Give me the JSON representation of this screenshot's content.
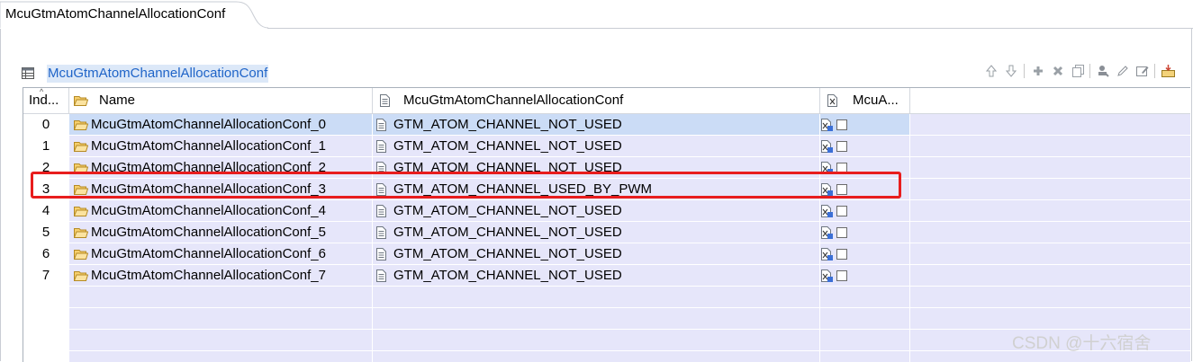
{
  "tab": {
    "label": "McuGtmAtomChannelAllocationConf"
  },
  "section": {
    "title": "McuGtmAtomChannelAllocationConf"
  },
  "toolbar": {
    "icons": [
      "arrow-up-icon",
      "arrow-down-icon",
      "add-icon",
      "delete-icon",
      "copy-icon",
      "stamp-icon",
      "edit-icon",
      "edit-properties-icon",
      "import-icon"
    ]
  },
  "table": {
    "columns": [
      {
        "label": "Ind..."
      },
      {
        "label": "Name"
      },
      {
        "label": "McuGtmAtomChannelAllocationConf"
      },
      {
        "label": "McuA..."
      }
    ],
    "rows": [
      {
        "index": "0",
        "name": "McuGtmAtomChannelAllocationConf_0",
        "value": "GTM_ATOM_CHANNEL_NOT_USED",
        "checked": false,
        "selected": true
      },
      {
        "index": "1",
        "name": "McuGtmAtomChannelAllocationConf_1",
        "value": "GTM_ATOM_CHANNEL_NOT_USED",
        "checked": false
      },
      {
        "index": "2",
        "name": "McuGtmAtomChannelAllocationConf_2",
        "value": "GTM_ATOM_CHANNEL_NOT_USED",
        "checked": false
      },
      {
        "index": "3",
        "name": "McuGtmAtomChannelAllocationConf_3",
        "value": "GTM_ATOM_CHANNEL_USED_BY_PWM",
        "checked": false,
        "highlighted": true
      },
      {
        "index": "4",
        "name": "McuGtmAtomChannelAllocationConf_4",
        "value": "GTM_ATOM_CHANNEL_NOT_USED",
        "checked": false
      },
      {
        "index": "5",
        "name": "McuGtmAtomChannelAllocationConf_5",
        "value": "GTM_ATOM_CHANNEL_NOT_USED",
        "checked": false
      },
      {
        "index": "6",
        "name": "McuGtmAtomChannelAllocationConf_6",
        "value": "GTM_ATOM_CHANNEL_NOT_USED",
        "checked": false
      },
      {
        "index": "7",
        "name": "McuGtmAtomChannelAllocationConf_7",
        "value": "GTM_ATOM_CHANNEL_NOT_USED",
        "checked": false
      }
    ],
    "empty_rows": 4
  },
  "colors": {
    "row_bg": "#e6e6fa",
    "selected_bg": "#cbdcf6",
    "highlight_border": "#e81d1d",
    "link_blue": "#1f64c8"
  },
  "watermark": "CSDN @十六宿舍"
}
